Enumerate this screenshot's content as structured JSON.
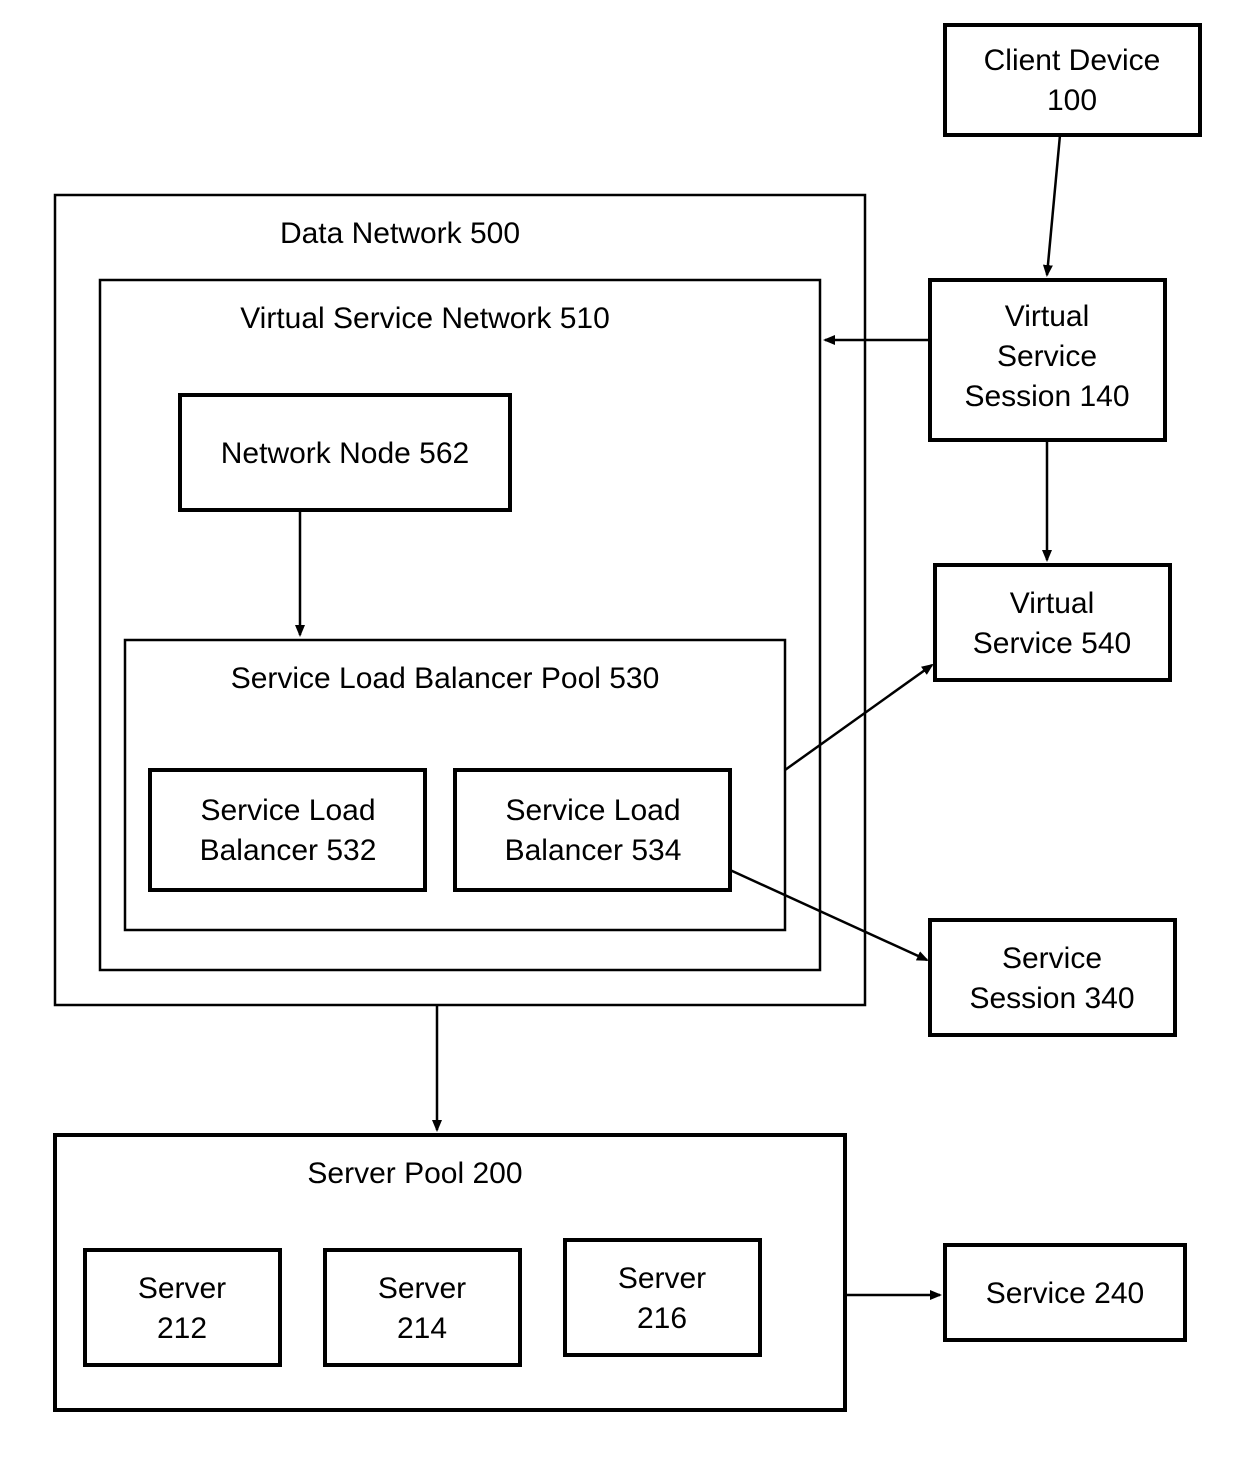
{
  "client_device": {
    "line1": "Client Device",
    "line2": "100"
  },
  "virtual_service_session": {
    "line1": "Virtual",
    "line2": "Service",
    "line3": "Session 140"
  },
  "virtual_service": {
    "line1": "Virtual",
    "line2": "Service 540"
  },
  "service_session_340": {
    "line1": "Service",
    "line2": "Session 340"
  },
  "data_network": {
    "title": "Data Network 500"
  },
  "virtual_service_network": {
    "title": "Virtual Service Network 510"
  },
  "network_node": {
    "label": "Network Node 562"
  },
  "slb_pool": {
    "title": "Service Load Balancer Pool 530"
  },
  "slb_532": {
    "line1": "Service Load",
    "line2": "Balancer 532"
  },
  "slb_534": {
    "line1": "Service Load",
    "line2": "Balancer 534"
  },
  "server_pool": {
    "title": "Server Pool 200"
  },
  "server_212": {
    "line1": "Server",
    "line2": "212"
  },
  "server_214": {
    "line1": "Server",
    "line2": "214"
  },
  "server_216": {
    "line1": "Server",
    "line2": "216"
  },
  "service_240": {
    "label": "Service 240"
  }
}
